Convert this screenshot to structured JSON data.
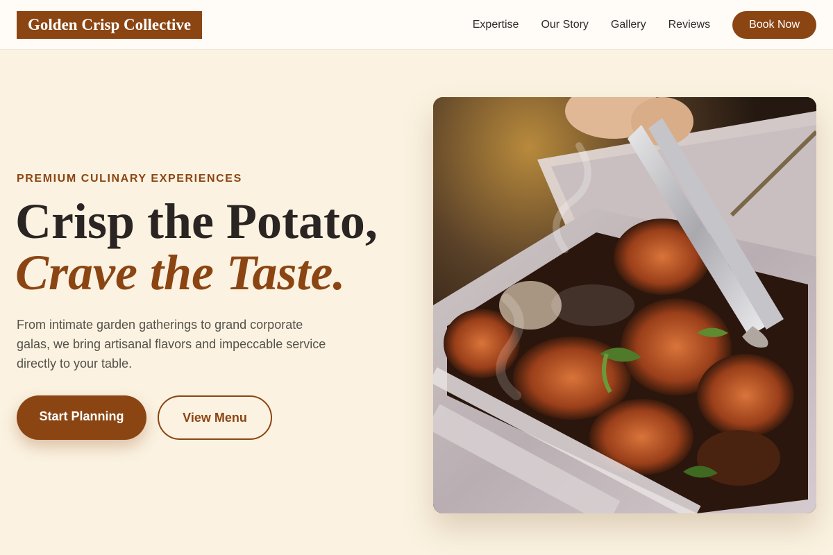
{
  "header": {
    "logo": "Golden Crisp Collective",
    "nav": [
      "Expertise",
      "Our Story",
      "Gallery",
      "Reviews"
    ],
    "cta": "Book Now"
  },
  "hero": {
    "eyebrow": "PREMIUM CULINARY EXPERIENCES",
    "headline_line1": "Crisp the Potato,",
    "headline_line2": "Crave the Taste.",
    "description": "From intimate garden gatherings to grand corporate galas, we bring artisanal flavors and impeccable service directly to your table.",
    "primary_button": "Start Planning",
    "secondary_button": "View Menu"
  },
  "colors": {
    "brand": "#8b4513",
    "background": "#fbf2e1",
    "header_bg": "#fffcf7",
    "text": "#2a2523"
  }
}
